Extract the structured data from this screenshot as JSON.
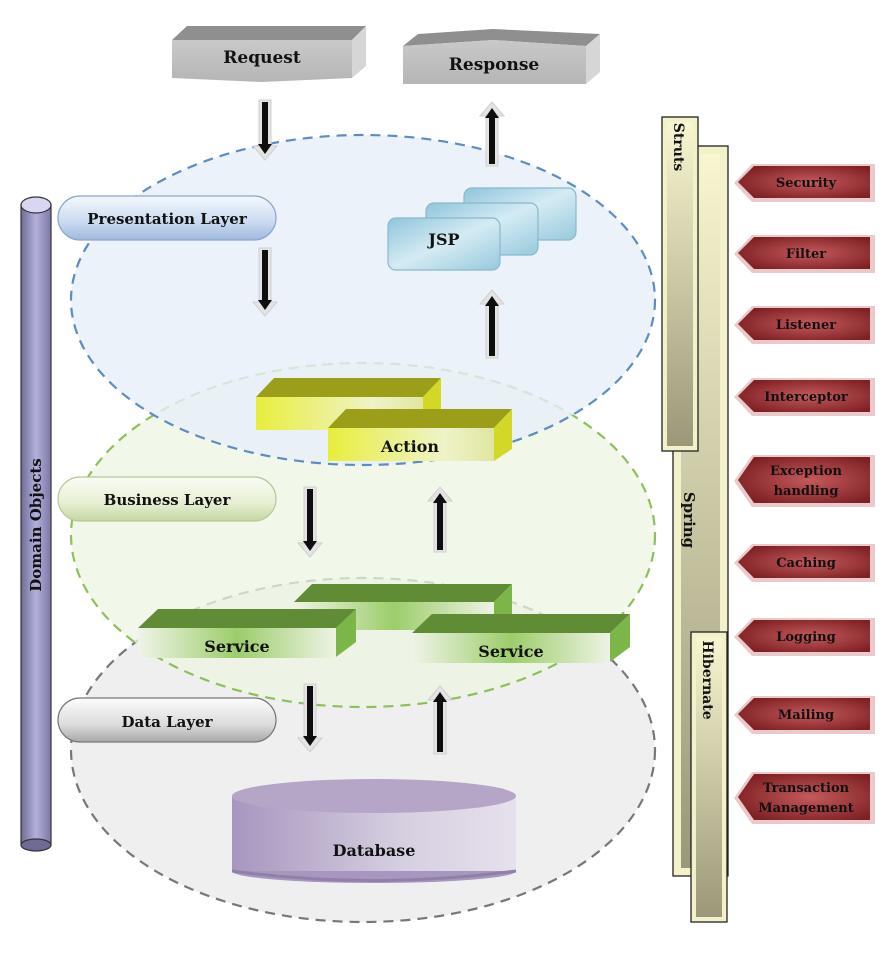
{
  "flow": {
    "request": "Request",
    "response": "Response"
  },
  "layers": [
    {
      "label": "Presentation Layer",
      "color": "#5b8cc4",
      "fill": "#e8f0fa"
    },
    {
      "label": "Business Layer",
      "color": "#8cc05a",
      "fill": "#eef6e2"
    },
    {
      "label": "Data Layer",
      "color": "#777777",
      "fill": "#eeeeee"
    }
  ],
  "components": {
    "jsp": "JSP",
    "action": "Action",
    "service_left": "Service",
    "service_right": "Service",
    "database": "Database"
  },
  "domain_objects": "Domain Objects",
  "frameworks": {
    "struts": "Struts",
    "spring": "Spring",
    "hibernate": "Hibernate"
  },
  "concerns": [
    [
      "Security"
    ],
    [
      "Filter"
    ],
    [
      "Listener"
    ],
    [
      "Interceptor"
    ],
    [
      "Exception",
      "handling"
    ],
    [
      "Caching"
    ],
    [
      "Logging"
    ],
    [
      "Mailing"
    ],
    [
      "Transaction",
      "Management"
    ]
  ],
  "colors": {
    "concern_fill": "#8e2b2e",
    "framework_bar": "#e6e4b8",
    "action_box": "#d8dc2a",
    "service_box": "#5f8c35",
    "jsp_box": "#a9d3e3",
    "database": "#b7a8c6",
    "domain_cylinder": "#8a86b0"
  }
}
